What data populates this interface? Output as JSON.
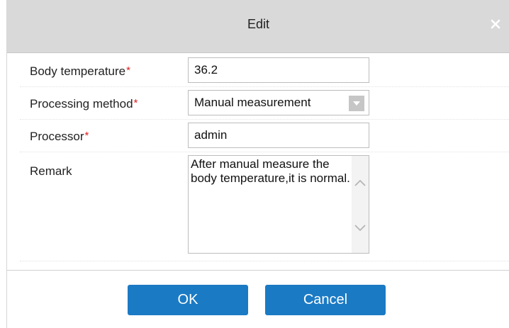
{
  "dialog": {
    "title": "Edit",
    "close_icon": "close-icon"
  },
  "form": {
    "body_temperature": {
      "label": "Body temperature",
      "required_mark": "*",
      "value": "36.2"
    },
    "processing_method": {
      "label": "Processing method",
      "required_mark": "*",
      "selected": "Manual measurement",
      "icon": "chevron-down-icon"
    },
    "processor": {
      "label": "Processor",
      "required_mark": "*",
      "value": "admin"
    },
    "remark": {
      "label": "Remark",
      "value": "After manual measure the body temperature,it is normal."
    }
  },
  "buttons": {
    "ok_label": "OK",
    "cancel_label": "Cancel"
  },
  "colors": {
    "titlebar": "#d9d9d9",
    "primary_button": "#1b7ac4",
    "required": "#e02020"
  }
}
